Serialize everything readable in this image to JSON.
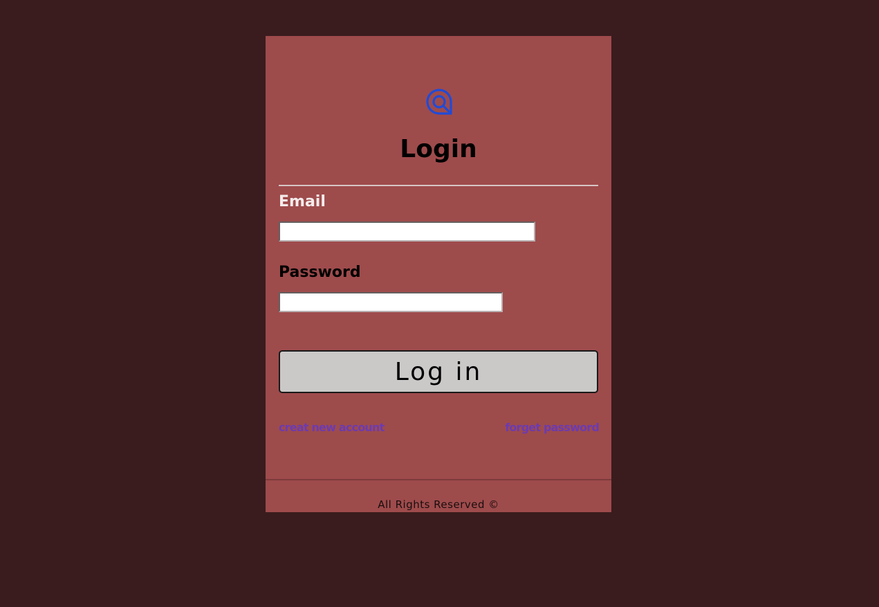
{
  "logo": {
    "icon": "at-sign-logo-icon",
    "color": "#1f4bd8"
  },
  "login": {
    "title": "Login",
    "email_label": "Email",
    "email_value": "",
    "password_label": "Password",
    "password_value": "",
    "submit_label": "Log in"
  },
  "links": {
    "create_account": "creat new account",
    "forget_password": "forget password"
  },
  "footer": {
    "text": "All Rights Reserved ©"
  },
  "colors": {
    "page_background": "#3a1c1e",
    "card_background": "#9e4b4c",
    "link": "#6c3bb0",
    "button_background": "#cbc8c8"
  }
}
